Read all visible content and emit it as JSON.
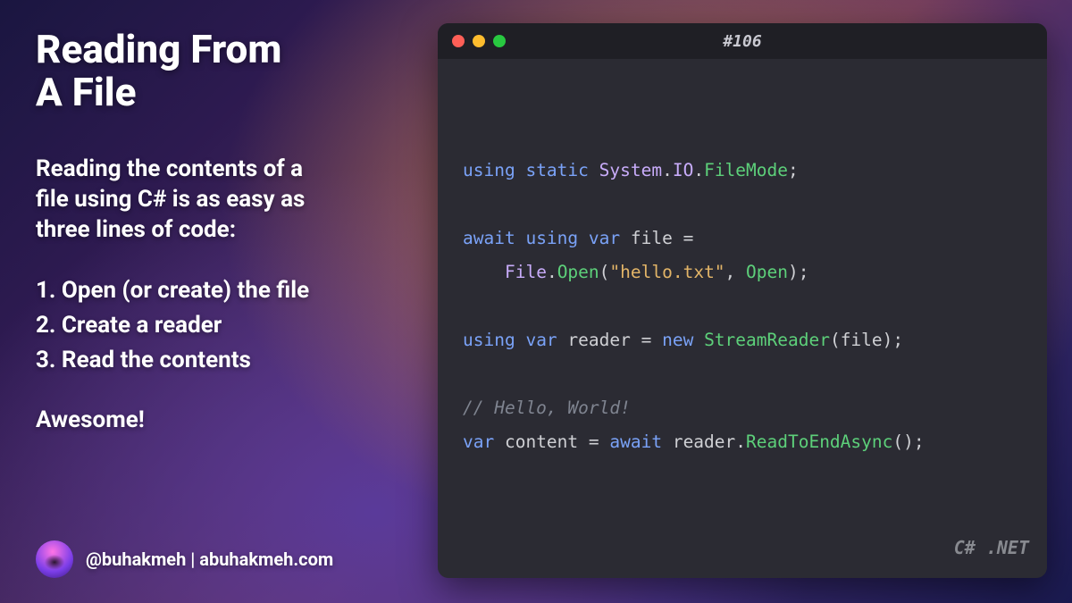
{
  "left": {
    "title_html": "Reading From<br>A File",
    "subtitle_html": "Reading the contents of a<br>file using C# is as easy as<br>three lines of code:",
    "steps": [
      "1. Open (or create) the file",
      "2. Create a reader",
      "3. Read the contents"
    ],
    "exclaim": "Awesome!"
  },
  "author": {
    "handle": "@buhakmeh",
    "separator": "  |  ",
    "site": "abuhakmeh.com"
  },
  "editor": {
    "window_title": "#106",
    "language_badge": "C# .NET",
    "traffic_lights": {
      "red": "#ff5f57",
      "yellow": "#febc2e",
      "green": "#28c840"
    }
  },
  "code": {
    "lines": [
      {
        "type": "code",
        "tokens": [
          {
            "t": "using ",
            "c": "kw"
          },
          {
            "t": "static ",
            "c": "kw"
          },
          {
            "t": "System",
            "c": "ns"
          },
          {
            "t": ".",
            "c": ""
          },
          {
            "t": "IO",
            "c": "ns"
          },
          {
            "t": ".",
            "c": ""
          },
          {
            "t": "FileMode",
            "c": "ty"
          },
          {
            "t": ";",
            "c": ""
          }
        ]
      },
      {
        "type": "blank"
      },
      {
        "type": "code",
        "tokens": [
          {
            "t": "await ",
            "c": "kw"
          },
          {
            "t": "using ",
            "c": "kw"
          },
          {
            "t": "var ",
            "c": "kw"
          },
          {
            "t": "file =",
            "c": ""
          }
        ]
      },
      {
        "type": "code",
        "tokens": [
          {
            "t": "    ",
            "c": ""
          },
          {
            "t": "File",
            "c": "ns"
          },
          {
            "t": ".",
            "c": ""
          },
          {
            "t": "Open",
            "c": "mth"
          },
          {
            "t": "(",
            "c": ""
          },
          {
            "t": "\"hello.txt\"",
            "c": "str"
          },
          {
            "t": ", ",
            "c": ""
          },
          {
            "t": "Open",
            "c": "ty"
          },
          {
            "t": ");",
            "c": ""
          }
        ]
      },
      {
        "type": "blank"
      },
      {
        "type": "code",
        "tokens": [
          {
            "t": "using ",
            "c": "kw"
          },
          {
            "t": "var ",
            "c": "kw"
          },
          {
            "t": "reader = ",
            "c": ""
          },
          {
            "t": "new ",
            "c": "kw"
          },
          {
            "t": "StreamReader",
            "c": "ty"
          },
          {
            "t": "(file);",
            "c": ""
          }
        ]
      },
      {
        "type": "blank"
      },
      {
        "type": "code",
        "tokens": [
          {
            "t": "// Hello, World!",
            "c": "cmt"
          }
        ]
      },
      {
        "type": "code",
        "tokens": [
          {
            "t": "var ",
            "c": "kw"
          },
          {
            "t": "content = ",
            "c": ""
          },
          {
            "t": "await ",
            "c": "kw"
          },
          {
            "t": "reader.",
            "c": ""
          },
          {
            "t": "ReadToEndAsync",
            "c": "mth"
          },
          {
            "t": "();",
            "c": ""
          }
        ]
      }
    ]
  }
}
